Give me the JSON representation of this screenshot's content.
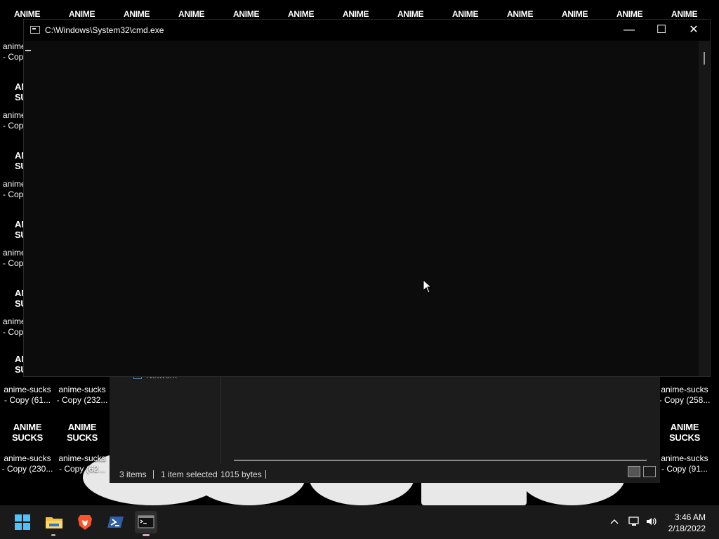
{
  "desktop": {
    "top_row_label": "ANIME",
    "icon_thumb_line1": "ANIME",
    "icon_thumb_line2": "SUCKS",
    "icon_thumb_partial1": "ANI",
    "icon_thumb_partial2": "SU",
    "left_column_labels": [
      {
        "line1": "anime",
        "line2": "- Cop"
      },
      {
        "line1": "anime",
        "line2": "- Cop"
      },
      {
        "line1": "anime",
        "line2": "- Cop"
      },
      {
        "line1": "anime",
        "line2": "- Cop"
      },
      {
        "line1": "anime",
        "line2": "- Cop"
      }
    ],
    "bottom_icons": [
      {
        "line1": "anime-sucks",
        "line2": "- Copy (61..."
      },
      {
        "line1": "anime-sucks",
        "line2": "- Copy (232..."
      },
      {
        "line1": "anime-sucks",
        "line2": "- Copy (258..."
      },
      {
        "line1": "anime-sucks",
        "line2": "- Copy (230..."
      },
      {
        "line1": "anime-sucks",
        "line2": "- Copy (62..."
      },
      {
        "line1": "anime-sucks",
        "line2": "- Copy (91..."
      }
    ]
  },
  "cmd": {
    "title": "C:\\Windows\\System32\\cmd.exe",
    "minimize": "—",
    "maximize": "☐",
    "close": "✕"
  },
  "explorer": {
    "nav_item": "Network",
    "items_count": "3 items",
    "selected": "1 item selected",
    "size": "1015 bytes"
  },
  "taskbar": {
    "time": "3:46 AM",
    "date": "2/18/2022",
    "chevron": "^"
  },
  "colors": {
    "accent_start": "#4cc2ff",
    "brave": "#fb542b",
    "powershell": "#2d5fa6",
    "folder": "#f6c142"
  }
}
